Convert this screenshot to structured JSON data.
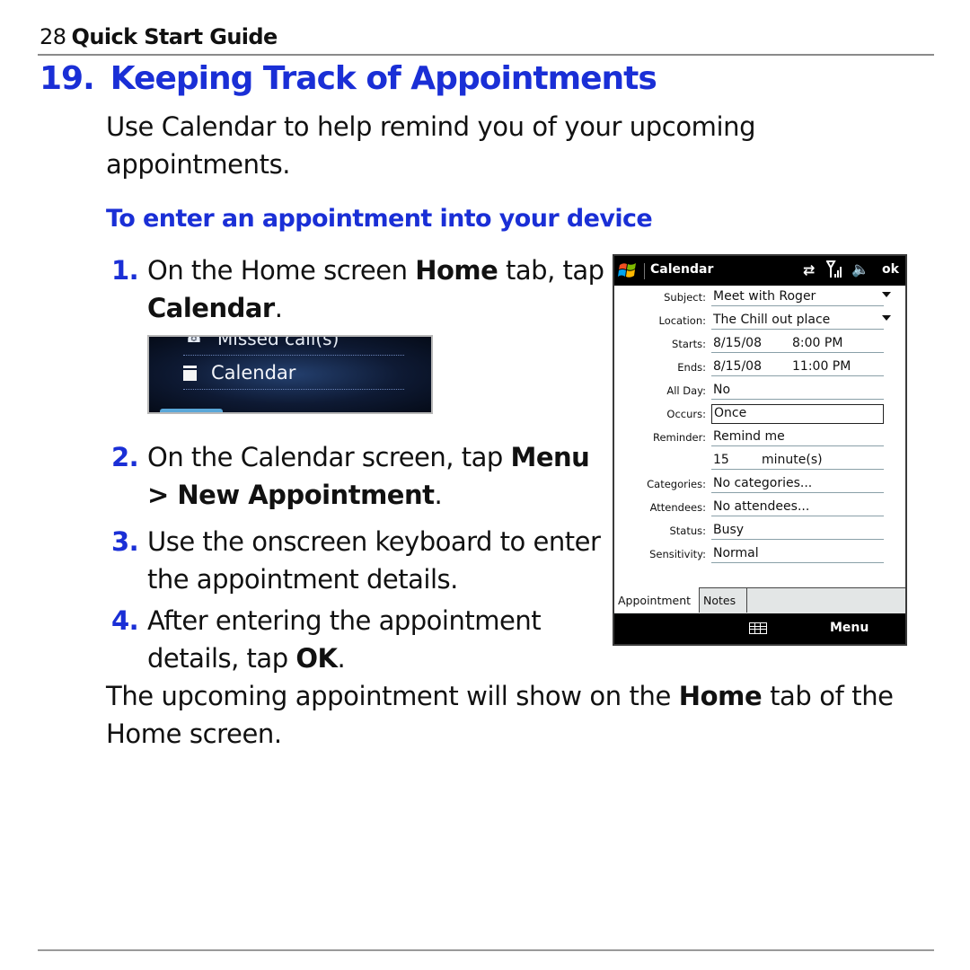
{
  "running_head": {
    "page_number": "28",
    "guide_title": "Quick Start Guide"
  },
  "section": {
    "number": "19.",
    "title": "Keeping Track of Appointments"
  },
  "intro": "Use Calendar to help remind you of your upcoming appointments.",
  "subheading": "To enter an appointment into your device",
  "steps": [
    {
      "num": "1.",
      "parts": [
        "On the Home screen ",
        "Home",
        " tab, tap ",
        "Calendar",
        "."
      ]
    },
    {
      "num": "2.",
      "parts": [
        "On the Calendar screen, tap ",
        "Menu",
        " > ",
        "New Appointment",
        "."
      ]
    },
    {
      "num": "3.",
      "parts": [
        "Use the onscreen keyboard to enter the appointment details."
      ]
    },
    {
      "num": "4.",
      "parts": [
        "After entering the appointment details, tap ",
        "OK",
        "."
      ]
    }
  ],
  "outro": {
    "parts": [
      "The upcoming appointment will show on the ",
      "Home",
      " tab of the Home screen."
    ]
  },
  "home_screenshot": {
    "missed_calls": "Missed call(s)",
    "calendar": "Calendar"
  },
  "phone": {
    "title": "Calendar",
    "ok": "ok",
    "fields": [
      {
        "label": "Subject:",
        "value": "Meet with Roger",
        "dropdown": true
      },
      {
        "label": "Location:",
        "value": "The Chill out place",
        "dropdown": true
      },
      {
        "label": "Starts:",
        "value": "8/15/08",
        "value2": "8:00 PM"
      },
      {
        "label": "Ends:",
        "value": "8/15/08",
        "value2": "11:00 PM"
      },
      {
        "label": "All Day:",
        "value": "No"
      },
      {
        "label": "Occurs:",
        "value": "Once",
        "focused": true
      },
      {
        "label": "Reminder:",
        "value": "Remind me"
      },
      {
        "label": "",
        "value": "15",
        "value2": "minute(s)"
      },
      {
        "label": "Categories:",
        "value": "No categories..."
      },
      {
        "label": "Attendees:",
        "value": "No attendees..."
      },
      {
        "label": "Status:",
        "value": "Busy"
      },
      {
        "label": "Sensitivity:",
        "value": "Normal"
      }
    ],
    "tabs": [
      "Appointment",
      "Notes"
    ],
    "softkey_right": "Menu"
  },
  "colors": {
    "accent_blue": "#1a2fd6",
    "rule_gray": "#8a8a8a"
  }
}
